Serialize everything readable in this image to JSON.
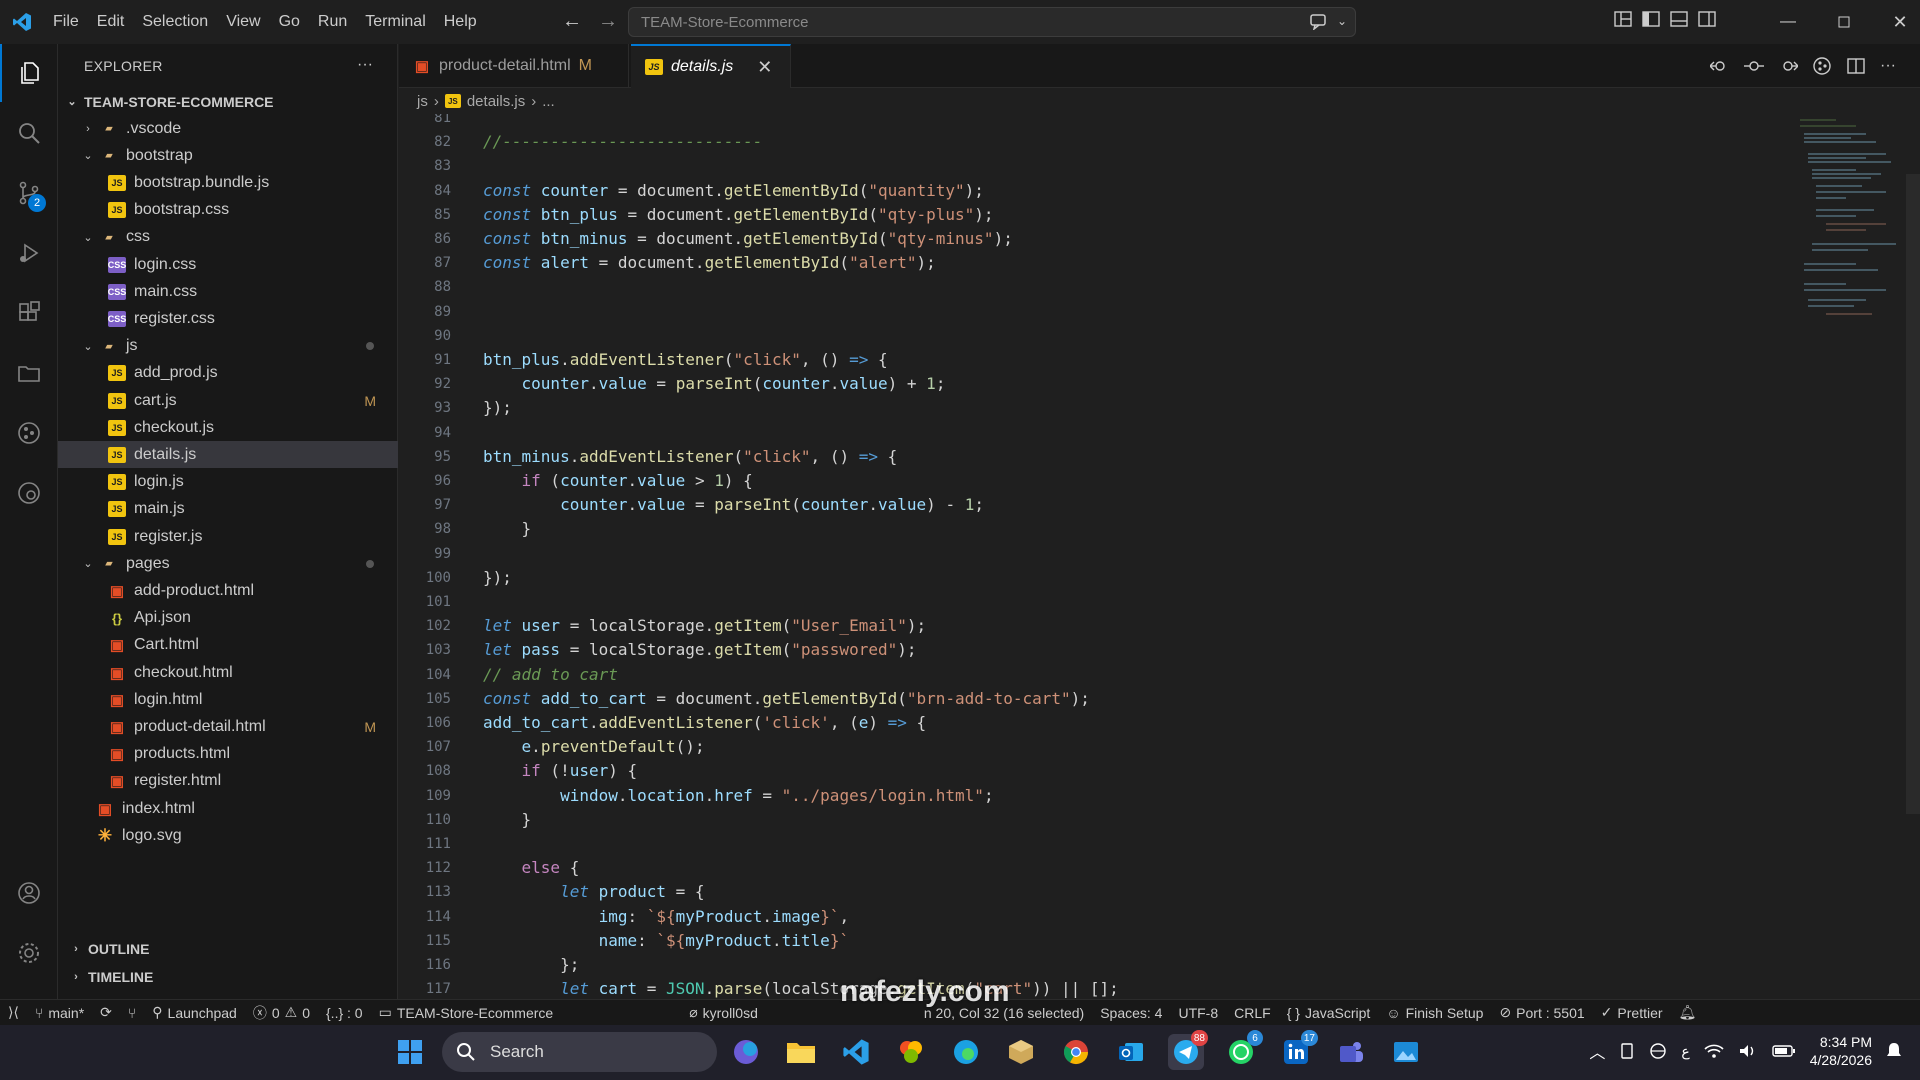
{
  "titlebar": {
    "menu": [
      "File",
      "Edit",
      "Selection",
      "View",
      "Go",
      "Run",
      "Terminal",
      "Help"
    ],
    "command_center": "TEAM-Store-Ecommerce"
  },
  "activity": {
    "scm_badge": "2"
  },
  "explorer": {
    "title": "EXPLORER",
    "more": "···",
    "root": "TEAM-STORE-ECOMMERCE",
    "items": [
      {
        "label": ".vscode",
        "type": "folder",
        "depth": 1,
        "chev": "›"
      },
      {
        "label": "bootstrap",
        "type": "folder",
        "depth": 1,
        "chev": "⌄"
      },
      {
        "label": "bootstrap.bundle.js",
        "type": "js",
        "depth": 2
      },
      {
        "label": "bootstrap.css",
        "type": "js",
        "depth": 2
      },
      {
        "label": "css",
        "type": "folder",
        "depth": 1,
        "chev": "⌄"
      },
      {
        "label": "login.css",
        "type": "css",
        "depth": 2
      },
      {
        "label": "main.css",
        "type": "css",
        "depth": 2
      },
      {
        "label": "register.css",
        "type": "css",
        "depth": 2
      },
      {
        "label": "js",
        "type": "folder",
        "depth": 1,
        "chev": "⌄",
        "dot": true
      },
      {
        "label": "add_prod.js",
        "type": "js",
        "depth": 2
      },
      {
        "label": "cart.js",
        "type": "js",
        "depth": 2,
        "mark": "M"
      },
      {
        "label": "checkout.js",
        "type": "js",
        "depth": 2
      },
      {
        "label": "details.js",
        "type": "js",
        "depth": 2,
        "selected": true
      },
      {
        "label": "login.js",
        "type": "js",
        "depth": 2
      },
      {
        "label": "main.js",
        "type": "js",
        "depth": 2
      },
      {
        "label": "register.js",
        "type": "js",
        "depth": 2
      },
      {
        "label": "pages",
        "type": "folder",
        "depth": 1,
        "chev": "⌄",
        "dot": true
      },
      {
        "label": "add-product.html",
        "type": "html",
        "depth": 2
      },
      {
        "label": "Api.json",
        "type": "json",
        "depth": 2
      },
      {
        "label": "Cart.html",
        "type": "html",
        "depth": 2
      },
      {
        "label": "checkout.html",
        "type": "html",
        "depth": 2
      },
      {
        "label": "login.html",
        "type": "html",
        "depth": 2
      },
      {
        "label": "product-detail.html",
        "type": "html",
        "depth": 2,
        "mark": "M"
      },
      {
        "label": "products.html",
        "type": "html",
        "depth": 2
      },
      {
        "label": "register.html",
        "type": "html",
        "depth": 2
      },
      {
        "label": "index.html",
        "type": "html",
        "depth": 1
      },
      {
        "label": "logo.svg",
        "type": "svg",
        "depth": 1
      }
    ],
    "outline": "OUTLINE",
    "timeline": "TIMELINE"
  },
  "tabs": [
    {
      "label": "product-detail.html",
      "mark": "M",
      "active": false
    },
    {
      "label": "details.js",
      "close": "✕",
      "active": true
    }
  ],
  "breadcrumb": {
    "folder": "js",
    "file": "details.js",
    "more": "..."
  },
  "code": [
    {
      "n": "81",
      "t": []
    },
    {
      "n": "82",
      "t": [
        [
          "c",
          "//---------------------------"
        ]
      ]
    },
    {
      "n": "83",
      "t": []
    },
    {
      "n": "84",
      "t": [
        [
          "k",
          "const "
        ],
        [
          "v",
          "counter"
        ],
        [
          "p",
          " = document."
        ],
        [
          "f",
          "getElementById"
        ],
        [
          "p",
          "("
        ],
        [
          "s",
          "\"quantity\""
        ],
        [
          "p",
          ");"
        ]
      ]
    },
    {
      "n": "85",
      "t": [
        [
          "k",
          "const "
        ],
        [
          "v",
          "btn_plus"
        ],
        [
          "p",
          " = document."
        ],
        [
          "f",
          "getElementById"
        ],
        [
          "p",
          "("
        ],
        [
          "s",
          "\"qty-plus\""
        ],
        [
          "p",
          ");"
        ]
      ]
    },
    {
      "n": "86",
      "t": [
        [
          "k",
          "const "
        ],
        [
          "v",
          "btn_minus"
        ],
        [
          "p",
          " = document."
        ],
        [
          "f",
          "getElementById"
        ],
        [
          "p",
          "("
        ],
        [
          "s",
          "\"qty-minus\""
        ],
        [
          "p",
          ");"
        ]
      ]
    },
    {
      "n": "87",
      "t": [
        [
          "k",
          "const "
        ],
        [
          "v",
          "alert"
        ],
        [
          "p",
          " = document."
        ],
        [
          "f",
          "getElementById"
        ],
        [
          "p",
          "("
        ],
        [
          "s",
          "\"alert\""
        ],
        [
          "p",
          ");"
        ]
      ]
    },
    {
      "n": "88",
      "t": []
    },
    {
      "n": "89",
      "t": []
    },
    {
      "n": "90",
      "t": []
    },
    {
      "n": "91",
      "t": [
        [
          "v",
          "btn_plus"
        ],
        [
          "p",
          "."
        ],
        [
          "f",
          "addEventListener"
        ],
        [
          "p",
          "("
        ],
        [
          "s",
          "\"click\""
        ],
        [
          "p",
          ", () "
        ],
        [
          "k",
          "=>"
        ],
        [
          "p",
          " {"
        ]
      ]
    },
    {
      "n": "92",
      "t": [
        [
          "p",
          "    "
        ],
        [
          "v",
          "counter"
        ],
        [
          "p",
          "."
        ],
        [
          "v",
          "value"
        ],
        [
          "p",
          " = "
        ],
        [
          "f",
          "parseInt"
        ],
        [
          "p",
          "("
        ],
        [
          "v",
          "counter"
        ],
        [
          "p",
          "."
        ],
        [
          "v",
          "value"
        ],
        [
          "p",
          ") + "
        ],
        [
          "n",
          "1"
        ],
        [
          "p",
          ";"
        ]
      ]
    },
    {
      "n": "93",
      "t": [
        [
          "p",
          "});"
        ]
      ]
    },
    {
      "n": "94",
      "t": []
    },
    {
      "n": "95",
      "t": [
        [
          "v",
          "btn_minus"
        ],
        [
          "p",
          "."
        ],
        [
          "f",
          "addEventListener"
        ],
        [
          "p",
          "("
        ],
        [
          "s",
          "\"click\""
        ],
        [
          "p",
          ", () "
        ],
        [
          "k",
          "=>"
        ],
        [
          "p",
          " {"
        ]
      ]
    },
    {
      "n": "96",
      "t": [
        [
          "p",
          "    "
        ],
        [
          "kw",
          "if"
        ],
        [
          "p",
          " ("
        ],
        [
          "v",
          "counter"
        ],
        [
          "p",
          "."
        ],
        [
          "v",
          "value"
        ],
        [
          "p",
          " > "
        ],
        [
          "n",
          "1"
        ],
        [
          "p",
          ") {"
        ]
      ]
    },
    {
      "n": "97",
      "t": [
        [
          "p",
          "        "
        ],
        [
          "v",
          "counter"
        ],
        [
          "p",
          "."
        ],
        [
          "v",
          "value"
        ],
        [
          "p",
          " = "
        ],
        [
          "f",
          "parseInt"
        ],
        [
          "p",
          "("
        ],
        [
          "v",
          "counter"
        ],
        [
          "p",
          "."
        ],
        [
          "v",
          "value"
        ],
        [
          "p",
          ") - "
        ],
        [
          "n",
          "1"
        ],
        [
          "p",
          ";"
        ]
      ]
    },
    {
      "n": "98",
      "t": [
        [
          "p",
          "    }"
        ]
      ]
    },
    {
      "n": "99",
      "t": []
    },
    {
      "n": "100",
      "t": [
        [
          "p",
          "});"
        ]
      ]
    },
    {
      "n": "101",
      "t": []
    },
    {
      "n": "102",
      "t": [
        [
          "k",
          "let "
        ],
        [
          "v",
          "user"
        ],
        [
          "p",
          " = localStorage."
        ],
        [
          "f",
          "getItem"
        ],
        [
          "p",
          "("
        ],
        [
          "s",
          "\"User_Email\""
        ],
        [
          "p",
          ");"
        ]
      ]
    },
    {
      "n": "103",
      "t": [
        [
          "k",
          "let "
        ],
        [
          "v",
          "pass"
        ],
        [
          "p",
          " = localStorage."
        ],
        [
          "f",
          "getItem"
        ],
        [
          "p",
          "("
        ],
        [
          "s",
          "\"passwored\""
        ],
        [
          "p",
          ");"
        ]
      ]
    },
    {
      "n": "104",
      "t": [
        [
          "c",
          "// add to cart"
        ]
      ]
    },
    {
      "n": "105",
      "t": [
        [
          "k",
          "const "
        ],
        [
          "v",
          "add_to_cart"
        ],
        [
          "p",
          " = document."
        ],
        [
          "f",
          "getElementById"
        ],
        [
          "p",
          "("
        ],
        [
          "s",
          "\"brn-add-to-cart\""
        ],
        [
          "p",
          ");"
        ]
      ]
    },
    {
      "n": "106",
      "t": [
        [
          "v",
          "add_to_cart"
        ],
        [
          "p",
          "."
        ],
        [
          "f",
          "addEventListener"
        ],
        [
          "p",
          "("
        ],
        [
          "s",
          "'click'"
        ],
        [
          "p",
          ", ("
        ],
        [
          "v",
          "e"
        ],
        [
          "p",
          ") "
        ],
        [
          "k",
          "=>"
        ],
        [
          "p",
          " {"
        ]
      ]
    },
    {
      "n": "107",
      "t": [
        [
          "p",
          "    "
        ],
        [
          "v",
          "e"
        ],
        [
          "p",
          "."
        ],
        [
          "f",
          "preventDefault"
        ],
        [
          "p",
          "();"
        ]
      ]
    },
    {
      "n": "108",
      "t": [
        [
          "p",
          "    "
        ],
        [
          "kw",
          "if"
        ],
        [
          "p",
          " (!"
        ],
        [
          "v",
          "user"
        ],
        [
          "p",
          ") {"
        ]
      ]
    },
    {
      "n": "109",
      "t": [
        [
          "p",
          "        "
        ],
        [
          "v",
          "window"
        ],
        [
          "p",
          "."
        ],
        [
          "v",
          "location"
        ],
        [
          "p",
          "."
        ],
        [
          "v",
          "href"
        ],
        [
          "p",
          " = "
        ],
        [
          "s",
          "\"../pages/login.html\""
        ],
        [
          "p",
          ";"
        ]
      ]
    },
    {
      "n": "110",
      "t": [
        [
          "p",
          "    }"
        ]
      ]
    },
    {
      "n": "111",
      "t": []
    },
    {
      "n": "112",
      "t": [
        [
          "p",
          "    "
        ],
        [
          "kw",
          "else"
        ],
        [
          "p",
          " {"
        ]
      ]
    },
    {
      "n": "113",
      "t": [
        [
          "p",
          "        "
        ],
        [
          "k",
          "let "
        ],
        [
          "v",
          "product"
        ],
        [
          "p",
          " = {"
        ]
      ]
    },
    {
      "n": "114",
      "t": [
        [
          "p",
          "            "
        ],
        [
          "v",
          "img"
        ],
        [
          "p",
          ": "
        ],
        [
          "s",
          "`${"
        ],
        [
          "v",
          "myProduct"
        ],
        [
          "p",
          "."
        ],
        [
          "v",
          "image"
        ],
        [
          "s",
          "}`"
        ],
        [
          "p",
          ","
        ]
      ]
    },
    {
      "n": "115",
      "t": [
        [
          "p",
          "            "
        ],
        [
          "v",
          "name"
        ],
        [
          "p",
          ": "
        ],
        [
          "s",
          "`${"
        ],
        [
          "v",
          "myProduct"
        ],
        [
          "p",
          "."
        ],
        [
          "v",
          "title"
        ],
        [
          "s",
          "}`"
        ]
      ]
    },
    {
      "n": "116",
      "t": [
        [
          "p",
          "        };"
        ]
      ]
    },
    {
      "n": "117",
      "t": [
        [
          "p",
          "        "
        ],
        [
          "k",
          "let "
        ],
        [
          "v",
          "cart"
        ],
        [
          "p",
          " = "
        ],
        [
          "cl",
          "JSON"
        ],
        [
          "p",
          "."
        ],
        [
          "f",
          "parse"
        ],
        [
          "p",
          "(localStorage."
        ],
        [
          "f",
          "getItem"
        ],
        [
          "p",
          "("
        ],
        [
          "s",
          "\"cart\""
        ],
        [
          "p",
          ")) || [];"
        ]
      ]
    }
  ],
  "statusbar": {
    "branch": "main*",
    "launchpad": "Launchpad",
    "errors": "0",
    "warnings": "0",
    "braces": "{..} : 0",
    "folder": "TEAM-Store-Ecommerce",
    "user": "kyroll0sd",
    "position": "n 20, Col 32 (16 selected)",
    "spaces": "Spaces: 4",
    "encoding": "UTF-8",
    "eol": "CRLF",
    "language": "JavaScript",
    "finish": "Finish Setup",
    "port": "Port : 5501",
    "prettier": "Prettier"
  },
  "taskbar": {
    "search": "Search",
    "badge_whatsapp": "6",
    "badge_linkedin": "17",
    "badge_telegram": "88",
    "time": "8:34 PM",
    "date": "4/28/2026",
    "lang": "ع"
  },
  "watermark": "nafezly.com"
}
